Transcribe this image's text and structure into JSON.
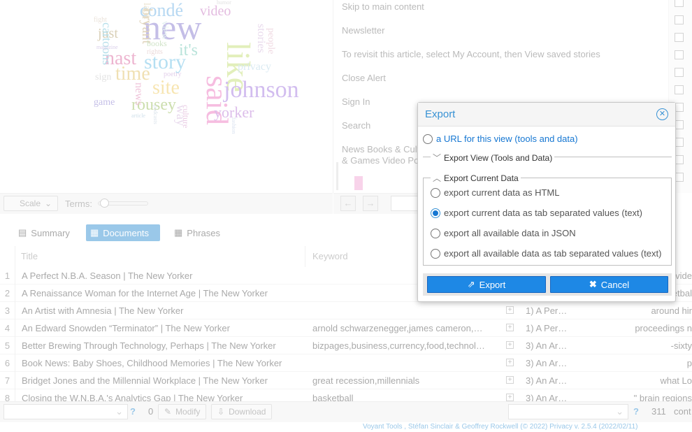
{
  "cloud": {
    "words": [
      {
        "text": "new",
        "color": "#8a7fd0"
      },
      {
        "text": "condé",
        "color": "#6fb2e6"
      },
      {
        "text": "video",
        "color": "#c979c2"
      },
      {
        "text": "like",
        "color": "#c6e07a"
      },
      {
        "text": "said",
        "color": "#ee7ec2"
      },
      {
        "text": "johnson",
        "color": "#a77de0"
      },
      {
        "text": "yorker",
        "color": "#ba7ed6"
      },
      {
        "text": "story",
        "color": "#6ec0e6"
      },
      {
        "text": "nast",
        "color": "#dd6ea2"
      },
      {
        "text": "time",
        "color": "#e3c36a"
      },
      {
        "text": "site",
        "color": "#f0cc66"
      },
      {
        "text": "rousey",
        "color": "#9bbe5e"
      },
      {
        "text": "it's",
        "color": "#76c9b6"
      },
      {
        "text": "just",
        "color": "#b4a070"
      },
      {
        "text": "cartoons",
        "color": "#6fc1d6"
      },
      {
        "text": "bryant",
        "color": "#c3aa7a"
      },
      {
        "text": "privacy",
        "color": "#b6d6e6"
      },
      {
        "text": "stories",
        "color": "#d2b4da"
      },
      {
        "text": "game",
        "color": "#8a7fd0"
      },
      {
        "text": "news",
        "color": "#e08ab6"
      },
      {
        "text": "way",
        "color": "#d2b4da"
      },
      {
        "text": "culture",
        "color": "#d394c6"
      },
      {
        "text": "sign",
        "color": "#c6c6c6"
      },
      {
        "text": "books",
        "color": "#a0c890"
      },
      {
        "text": "later",
        "color": "#d6c69a"
      },
      {
        "text": "people",
        "color": "#e0b4c6"
      },
      {
        "text": "view",
        "color": "#c6e0e0"
      },
      {
        "text": "fight",
        "color": "#d6c6b6"
      },
      {
        "text": "poetry",
        "color": "#c6a0d6"
      },
      {
        "text": "magazine",
        "color": "#b4a0d6"
      },
      {
        "text": "rights",
        "color": "#d6b4b4"
      },
      {
        "text": "article",
        "color": "#a0c0d6"
      },
      {
        "text": "podcasts",
        "color": "#b6c6d6"
      },
      {
        "text": "humor",
        "color": "#c6c6c6"
      },
      {
        "text": "fashion",
        "color": "#b6c6e0"
      }
    ]
  },
  "cloud_toolbar": {
    "scale_label": "Scale",
    "terms_label": "Terms:"
  },
  "reader": {
    "lines": [
      "Skip to main content",
      "Newsletter",
      "To revisit this article, select My Account, then View saved stories",
      "Close Alert",
      "Sign In",
      "Search",
      "News Books & Cult",
      "& Games Video Po"
    ]
  },
  "tabs": {
    "summary": "Summary",
    "documents": "Documents",
    "phrases": "Phrases"
  },
  "grid": {
    "headers": {
      "title": "Title",
      "keyword": "Keyword"
    },
    "rows": [
      {
        "n": "1",
        "title": "A Perfect N.B.A. Season | The New Yorker",
        "keyword": "",
        "ctx": "",
        "right": "evide"
      },
      {
        "n": "2",
        "title": "A Renaissance Woman for the Internet Age | The New Yorker",
        "keyword": "",
        "ctx": "",
        "right": "etbal"
      },
      {
        "n": "3",
        "title": "An Artist with Amnesia | The New Yorker",
        "keyword": "",
        "ctx": "1) A Per…",
        "right": "around hir"
      },
      {
        "n": "4",
        "title": "An Edward Snowden “Terminator” | The New Yorker",
        "keyword": "arnold schwarzenegger,james cameron,…",
        "ctx": "1) A Per…",
        "right": "proceedings n"
      },
      {
        "n": "5",
        "title": "Better Brewing Through Technology, Perhaps | The New Yorker",
        "keyword": "bizpages,business,currency,food,technol…",
        "ctx": "3) An Ar…",
        "right": "sixty-"
      },
      {
        "n": "6",
        "title": "Book News: Baby Shoes, Childhood Memories | The New Yorker",
        "keyword": "",
        "ctx": "3) An Ar…",
        "right": "p"
      },
      {
        "n": "7",
        "title": "Bridget Jones and the Millennial Workplace | The New Yorker",
        "keyword": "great recession,millennials",
        "ctx": "3) An Ar…",
        "right": "what Lo"
      },
      {
        "n": "8",
        "title": "Closing the W.N.B.A.'s Analytics Gap | The New Yorker",
        "keyword": "basketball",
        "ctx": "3) An Ar…",
        "right": "brain regions \""
      }
    ]
  },
  "bottombar": {
    "count_left": "0",
    "modify": "Modify",
    "download": "Download",
    "count_right": "311",
    "cont": "cont"
  },
  "footer": {
    "text": "Voyant Tools , Stéfan Sinclair & Geoffrey Rockwell (© 2022) Privacy v. 2.5.4 (2022/02/11)"
  },
  "dialog": {
    "title": "Export",
    "url_option": "a URL for this view (tools and data)",
    "export_view_legend": "Export View (Tools and Data)",
    "current_data_legend": "Export Current Data",
    "options": [
      {
        "label": "export current data as HTML",
        "selected": false
      },
      {
        "label": "export current data as tab separated values (text)",
        "selected": true
      },
      {
        "label": "export all available data in JSON",
        "selected": false
      },
      {
        "label": "export all available data as tab separated values (text)",
        "selected": false
      }
    ],
    "export_button": "Export",
    "cancel_button": "Cancel"
  }
}
